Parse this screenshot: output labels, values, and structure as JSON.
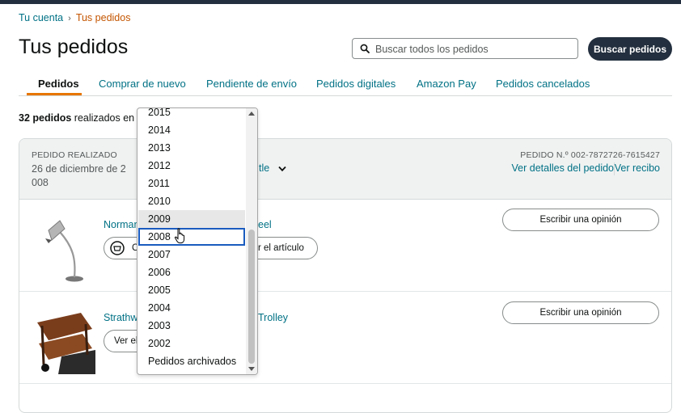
{
  "breadcrumb": {
    "account": "Tu cuenta",
    "separator": "›",
    "current": "Tus pedidos"
  },
  "page_title": "Tus pedidos",
  "search": {
    "placeholder": "Buscar todos los pedidos",
    "value": "",
    "button_label": "Buscar pedidos"
  },
  "tabs": [
    {
      "label": "Pedidos",
      "active": true
    },
    {
      "label": "Comprar de nuevo",
      "active": false
    },
    {
      "label": "Pendiente de envío",
      "active": false
    },
    {
      "label": "Pedidos digitales",
      "active": false
    },
    {
      "label": "Amazon Pay",
      "active": false
    },
    {
      "label": "Pedidos cancelados",
      "active": false
    }
  ],
  "order_count": {
    "count": "32 pedidos",
    "suffix": "realizados en"
  },
  "order": {
    "placed_label": "PEDIDO REALIZADO",
    "placed_date_line1": "26 de diciembre de 2",
    "placed_date_line2": "008",
    "ship_to_fragment": "tle",
    "order_number_label": "PEDIDO N.º 002-7872726-7615427",
    "details_link": "Ver detalles del pedido",
    "receipt_link": "Ver recibo"
  },
  "items": [
    {
      "title_left": "Norman",
      "title_right": "eel",
      "button_left": "C",
      "button_right": "r el artículo",
      "review_label": "Escribir una opinión"
    },
    {
      "title_left": "Strathw",
      "title_right": "Trolley",
      "button_left": "Ver el",
      "review_label": "Escribir una opinión"
    }
  ],
  "year_dropdown": {
    "options": [
      "2015",
      "2014",
      "2013",
      "2012",
      "2011",
      "2010",
      "2009",
      "2008",
      "2007",
      "2006",
      "2005",
      "2004",
      "2003",
      "2002",
      "Pedidos archivados"
    ],
    "hovered": "2009",
    "selected": "2008"
  },
  "colors": {
    "link": "#007185",
    "accent": "#e77600",
    "dark_button": "#232f3e",
    "breadcrumb_current": "#C45500"
  }
}
